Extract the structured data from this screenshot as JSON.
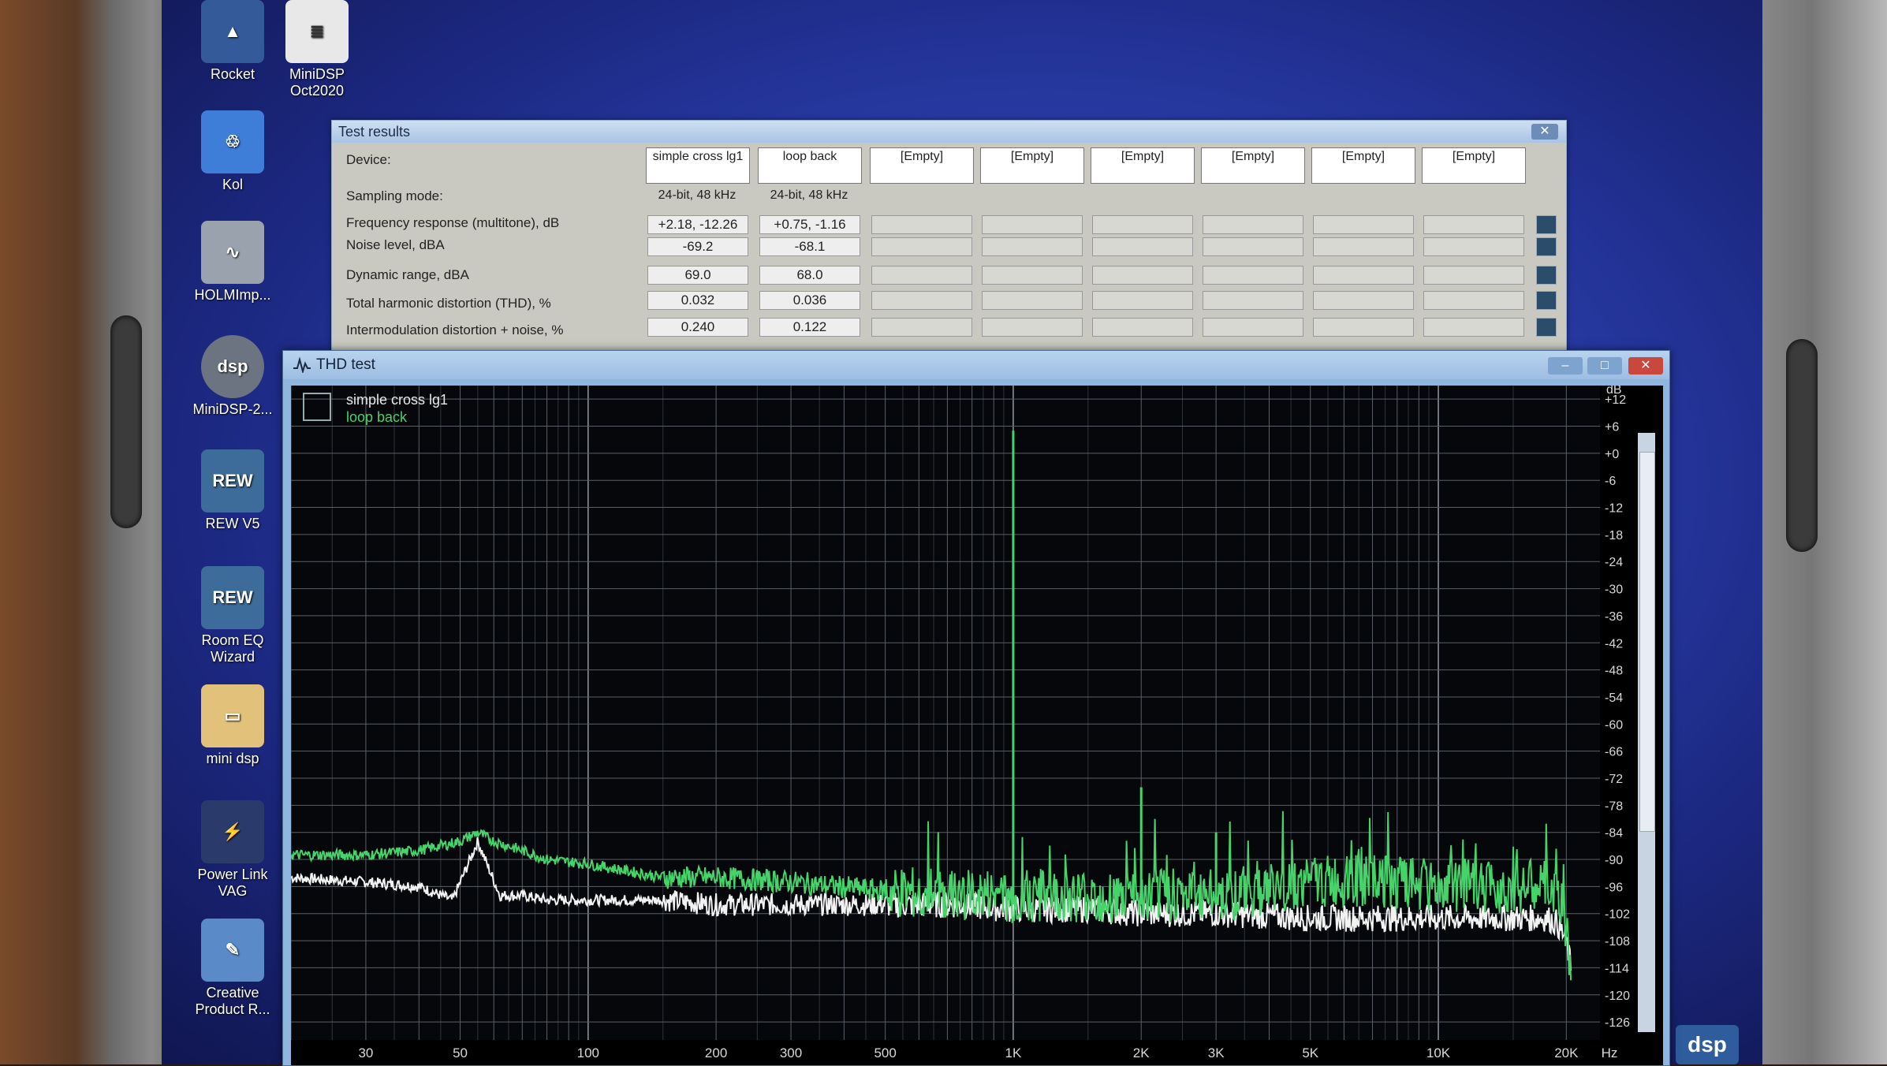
{
  "desktop": {
    "icons": [
      {
        "label": "Rocket"
      },
      {
        "label": "MiniDSP Oct2020"
      },
      {
        "label": "Kol"
      },
      {
        "label": "HOLMImp..."
      },
      {
        "label": "MiniDSP-2..."
      },
      {
        "label": "REW V5"
      },
      {
        "label": "Room EQ Wizard"
      },
      {
        "label": "mini dsp"
      },
      {
        "label": "Power Link VAG"
      },
      {
        "label": "Creative Product R..."
      }
    ],
    "rew_badge": "REW"
  },
  "test_results": {
    "title": "Test results",
    "close_glyph": "✕",
    "labels": {
      "device": "Device:",
      "sampling": "Sampling mode:",
      "freq": "Frequency response (multitone), dB",
      "noise": "Noise level, dBA",
      "dyn": "Dynamic range, dBA",
      "thd": "Total harmonic distortion (THD), %",
      "imd": "Intermodulation distortion + noise, %"
    },
    "devices": [
      "simple cross lg1",
      "loop back",
      "[Empty]",
      "[Empty]",
      "[Empty]",
      "[Empty]",
      "[Empty]",
      "[Empty]"
    ],
    "sampling": [
      "24-bit, 48 kHz",
      "24-bit, 48 kHz"
    ],
    "freq": [
      "+2.18, -12.26",
      "+0.75, -1.16"
    ],
    "noise": [
      "-69.2",
      "-68.1"
    ],
    "dyn": [
      "69.0",
      "68.0"
    ],
    "thd": [
      "0.032",
      "0.036"
    ],
    "imd": [
      "0.240",
      "0.122"
    ]
  },
  "thd_window": {
    "title": "THD test",
    "legend": [
      "simple cross lg1",
      "loop back"
    ],
    "btn_min": "–",
    "btn_max": "□",
    "btn_close": "✕"
  },
  "chart_data": {
    "type": "line",
    "x_unit": "Hz",
    "y_unit": "dB",
    "xlim": [
      20,
      24000
    ],
    "x_scale": "log",
    "ylim": [
      -130,
      15
    ],
    "grid": true,
    "x_ticks": [
      "30",
      "50",
      "100",
      "200",
      "300",
      "500",
      "1K",
      "2K",
      "3K",
      "5K",
      "10K",
      "20K",
      "Hz"
    ],
    "y_ticks": [
      "dB",
      "+12",
      "+6",
      "+0",
      "-6",
      "-12",
      "-18",
      "-24",
      "-30",
      "-36",
      "-42",
      "-48",
      "-54",
      "-60",
      "-66",
      "-72",
      "-78",
      "-84",
      "-90",
      "-96",
      "-102",
      "-108",
      "-114",
      "-120",
      "-126"
    ],
    "series": [
      {
        "name": "simple cross lg1",
        "color": "#45d36a",
        "x": [
          20,
          30,
          40,
          50,
          55,
          60,
          70,
          80,
          100,
          150,
          200,
          300,
          500,
          700,
          900,
          1000,
          1010,
          1100,
          1500,
          2000,
          2100,
          3000,
          3100,
          5000,
          7000,
          10000,
          15000,
          18000,
          19000,
          20000,
          20500
        ],
        "y": [
          -89,
          -89,
          -88,
          -86,
          -84,
          -86,
          -88,
          -90,
          -91,
          -94,
          -94,
          -95,
          -97,
          -98,
          -98,
          -99,
          -99,
          -98,
          -98,
          -99,
          -98,
          -98,
          -98,
          -95,
          -95,
          -96,
          -96,
          -96,
          -98,
          -104,
          -114
        ],
        "peaks": [
          {
            "x": 1000,
            "y": 5
          },
          {
            "x": 2000,
            "y": -74
          },
          {
            "x": 3000,
            "y": -84
          }
        ]
      },
      {
        "name": "loop back",
        "color": "#f2f2f2",
        "x": [
          20,
          30,
          40,
          48,
          55,
          62,
          70,
          80,
          100,
          150,
          200,
          300,
          500,
          700,
          1000,
          1500,
          2000,
          3000,
          5000,
          7000,
          10000,
          15000,
          18000,
          19000,
          20000,
          20500
        ],
        "y": [
          -94,
          -95,
          -96,
          -99,
          -86,
          -98,
          -98,
          -99,
          -99,
          -99,
          -100,
          -100,
          -100,
          -100,
          -101,
          -101,
          -102,
          -102,
          -103,
          -103,
          -103,
          -103,
          -103,
          -104,
          -108,
          -114
        ]
      }
    ]
  }
}
